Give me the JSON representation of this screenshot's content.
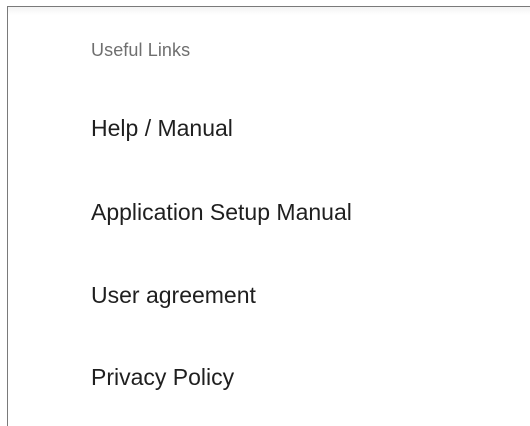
{
  "useful_links": {
    "header": "Useful Links",
    "items": [
      {
        "label": "Help / Manual"
      },
      {
        "label": "Application Setup Manual"
      },
      {
        "label": "User agreement"
      },
      {
        "label": "Privacy Policy"
      }
    ]
  }
}
